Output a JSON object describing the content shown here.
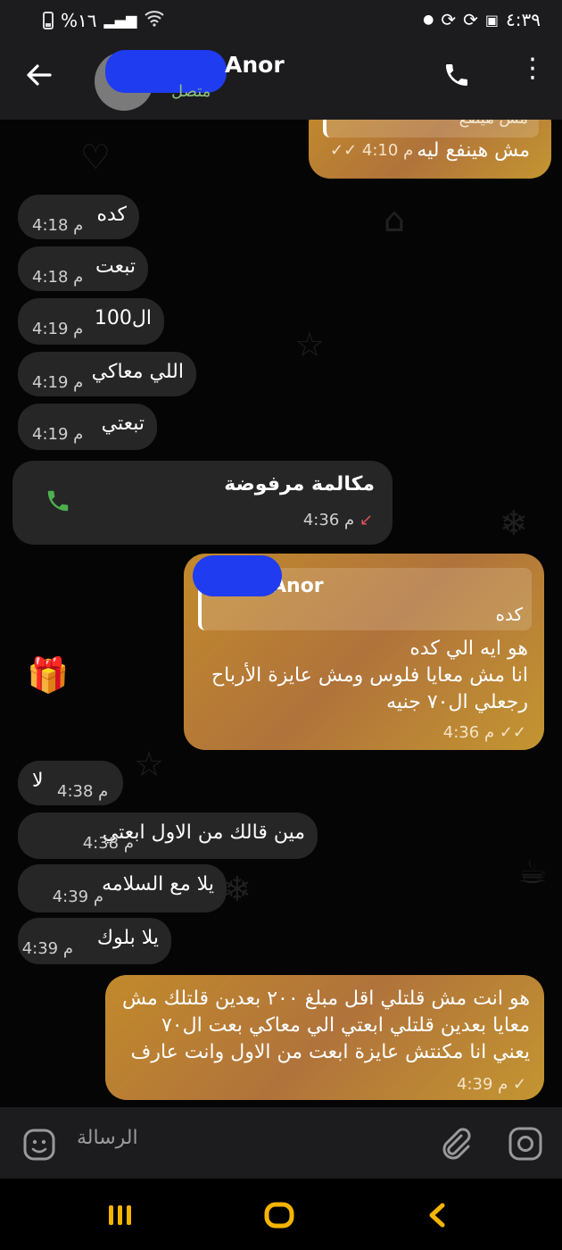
{
  "status_bar": {
    "battery": "%١٦",
    "time": "٤:٣٩"
  },
  "header": {
    "contact_name": "Anor",
    "contact_status": "متصل"
  },
  "messages": [
    {
      "quote": "مش هينفع",
      "text": "مش هينفع ليه",
      "time": "4:10",
      "ampm": "م"
    },
    {
      "text": "كده",
      "time": "4:18",
      "ampm": "م"
    },
    {
      "text": "تبعت",
      "time": "4:18",
      "ampm": "م"
    },
    {
      "text": "ال100",
      "time": "4:19",
      "ampm": "م"
    },
    {
      "text": "اللي معاكي",
      "time": "4:19",
      "ampm": "م"
    },
    {
      "text": "تبعتي",
      "time": "4:19",
      "ampm": "م"
    },
    {
      "text": "مكالمة مرفوضة",
      "time": "4:36",
      "ampm": "م"
    },
    {
      "quote_name": "Anor",
      "quote_text": "كده",
      "lines": [
        "هو ايه الي كده",
        "انا مش معايا فلوس ومش عايزة الأرباح",
        "رجعلي ال٧٠ جنيه"
      ],
      "time": "4:36",
      "ampm": "م"
    },
    {
      "text": "لا",
      "time": "4:38",
      "ampm": "م"
    },
    {
      "text": "مين قالك من الاول ابعتي",
      "time": "4:38",
      "ampm": "م"
    },
    {
      "text": "يلا مع السلامه",
      "time": "4:39",
      "ampm": "م"
    },
    {
      "text": "يلا بلوك",
      "time": "4:39",
      "ampm": "م"
    },
    {
      "lines": [
        "هو انت مش قلتلي اقل مبلغ ٢٠٠ بعدين قلتلك مش",
        "معايا بعدين قلتلي ابعتي الي معاكي بعت ال٧٠",
        "يعني انا مكنتش عايزة ابعت من الاول وانت عارف"
      ],
      "time": "4:39",
      "ampm": "م"
    }
  ],
  "input": {
    "placeholder": "الرسالة"
  },
  "colors": {
    "incoming": "#262626",
    "outgoing_start": "#c28a2c",
    "outgoing_end": "#b0733b",
    "declined_arrow": "#e0525c",
    "call_icon": "#4caf50",
    "online": "#8ec07c"
  }
}
